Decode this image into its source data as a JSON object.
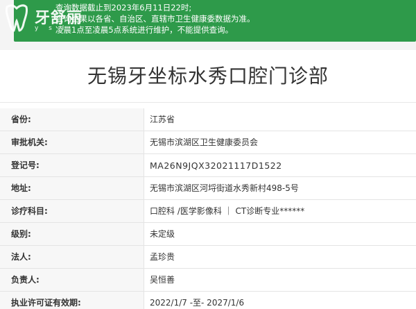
{
  "notice": {
    "lines": [
      "查询数据截止到2023年6月11日22时;",
      "查询结果以各省、自治区、直辖市卫生健康委数据为准。",
      "凌晨1点至凌晨5点系统进行维护，不能提供查询。"
    ],
    "bg_color": "#2e9a4a"
  },
  "watermark": {
    "text": "牙舒丽",
    "sub": "y s l"
  },
  "page_title": "无锡牙坐标水秀口腔门诊部",
  "fields": [
    {
      "label": "省份:",
      "value": "江苏省"
    },
    {
      "label": "审批机关:",
      "value": "无锡市滨湖区卫生健康委员会"
    },
    {
      "label": "登记号:",
      "value": "MA26N9JQX32021117D1522"
    },
    {
      "label": "地址:",
      "value": "无锡市滨湖区河埒街道水秀新村498-5号"
    },
    {
      "label": "诊疗科目:",
      "value": "口腔科 /医学影像科 ｜ CT诊断专业******"
    },
    {
      "label": "级别:",
      "value": "未定级"
    },
    {
      "label": "法人:",
      "value": "孟珍贵"
    },
    {
      "label": "负责人:",
      "value": "吴恒善"
    },
    {
      "label": "执业许可证有效期:",
      "value": "2022/1/7 -至- 2027/1/6"
    }
  ]
}
